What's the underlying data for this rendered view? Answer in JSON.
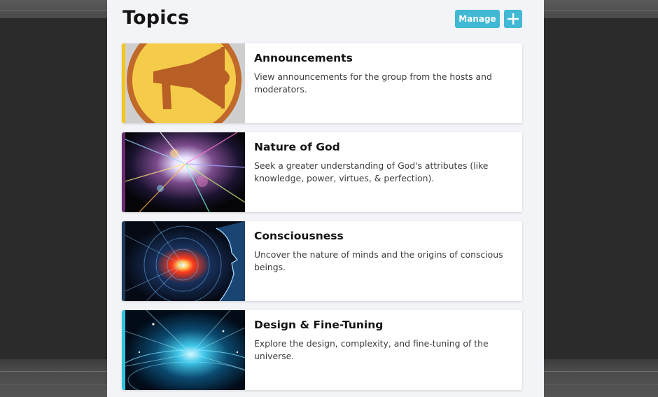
{
  "header": {
    "title": "Topics",
    "manage_label": "Manage",
    "add_icon": "plus-icon"
  },
  "colors": {
    "button": "#41b8d4",
    "panel_background": "#f3f4f8"
  },
  "topics": [
    {
      "title": "Announcements",
      "description": "View announcements for the group from the hosts and moderators.",
      "image": "megaphone-icon",
      "accent_color": "#f5c518"
    },
    {
      "title": "Nature of God",
      "description": "Seek a greater understanding of God's attributes (like knowledge, power, virtues, & perfection).",
      "image": "light-burst-image",
      "accent_color": "#6a2a6e"
    },
    {
      "title": "Consciousness",
      "description": "Uncover the nature of minds and the origins of conscious beings.",
      "image": "digital-head-image",
      "accent_color": "#1e3a5a"
    },
    {
      "title": "Design & Fine-Tuning",
      "description": "Explore the design, complexity, and fine-tuning of the universe.",
      "image": "glowing-universe-image",
      "accent_color": "#2ec4dc"
    }
  ]
}
